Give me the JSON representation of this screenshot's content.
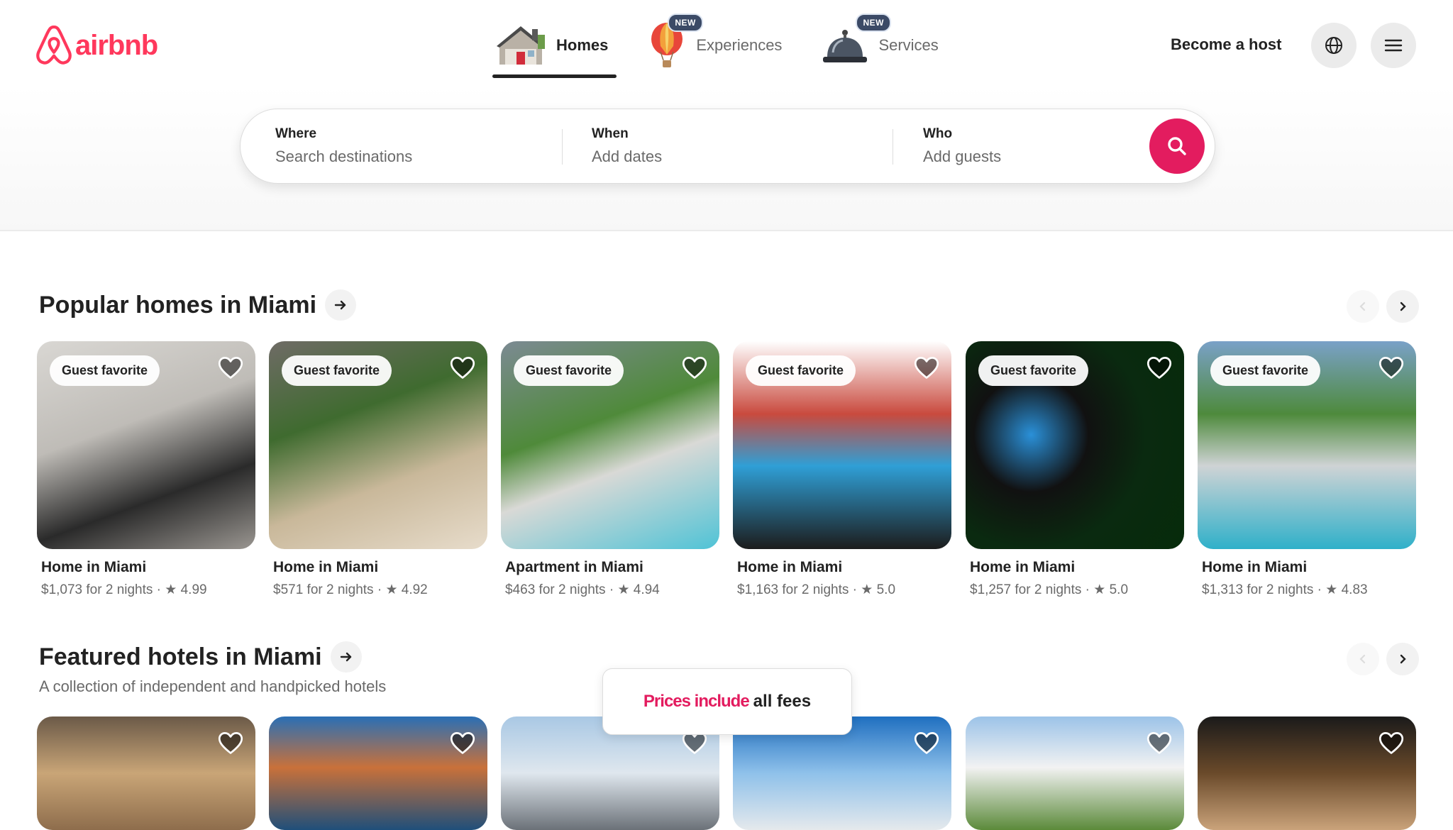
{
  "brand": {
    "name": "airbnb",
    "color": "#ff385c"
  },
  "nav": {
    "tabs": [
      {
        "label": "Homes",
        "icon": "house-icon",
        "active": true,
        "badge": ""
      },
      {
        "label": "Experiences",
        "icon": "hot-air-balloon-icon",
        "active": false,
        "badge": "NEW"
      },
      {
        "label": "Services",
        "icon": "service-bell-icon",
        "active": false,
        "badge": "NEW"
      }
    ],
    "host_link": "Become a host",
    "globe_icon": "globe-icon",
    "menu_icon": "hamburger-menu-icon"
  },
  "search": {
    "where": {
      "title": "Where",
      "placeholder": "Search destinations"
    },
    "when": {
      "title": "When",
      "placeholder": "Add dates"
    },
    "who": {
      "title": "Who",
      "placeholder": "Add guests"
    },
    "button_icon": "search-icon",
    "button_color": "#e31c5f"
  },
  "popular": {
    "title": "Popular homes in Miami",
    "listings": [
      {
        "badge": "Guest favorite",
        "title": "Home in Miami",
        "price": "$1,073 for 2 nights",
        "rating": "4.99"
      },
      {
        "badge": "Guest favorite",
        "title": "Home in Miami",
        "price": "$571 for 2 nights",
        "rating": "4.92"
      },
      {
        "badge": "Guest favorite",
        "title": "Apartment in Miami",
        "price": "$463 for 2 nights",
        "rating": "4.94"
      },
      {
        "badge": "Guest favorite",
        "title": "Home in Miami",
        "price": "$1,163 for 2 nights",
        "rating": "5.0"
      },
      {
        "badge": "Guest favorite",
        "title": "Home in Miami",
        "price": "$1,257 for 2 nights",
        "rating": "5.0"
      },
      {
        "badge": "Guest favorite",
        "title": "Home in Miami",
        "price": "$1,313 for 2 nights",
        "rating": "4.83"
      }
    ]
  },
  "hotels": {
    "title": "Featured hotels in Miami",
    "subtitle": "A collection of independent and handpicked hotels"
  },
  "toast": {
    "highlight": "Prices include",
    "rest": "all fees"
  },
  "separator": "·",
  "star": "★"
}
